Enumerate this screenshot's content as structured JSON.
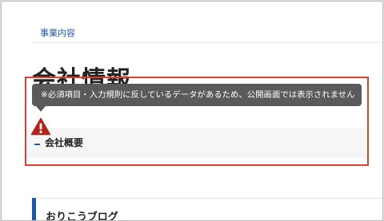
{
  "breadcrumb": {
    "label": "事業内容"
  },
  "page": {
    "title": "会社情報"
  },
  "tooltip": {
    "message": "※必須項目・入力規則に反しているデータがあるため、公開画面では表示されません"
  },
  "section": {
    "title": "会社概要"
  },
  "blog": {
    "title": "おりこうブログ"
  },
  "icons": {
    "warning": "warning-triangle-icon"
  },
  "colors": {
    "accent": "#1f5aa6",
    "error_outline": "#d9422e",
    "warning_icon": "#b3241c",
    "tooltip_bg": "#5a5a5a"
  }
}
